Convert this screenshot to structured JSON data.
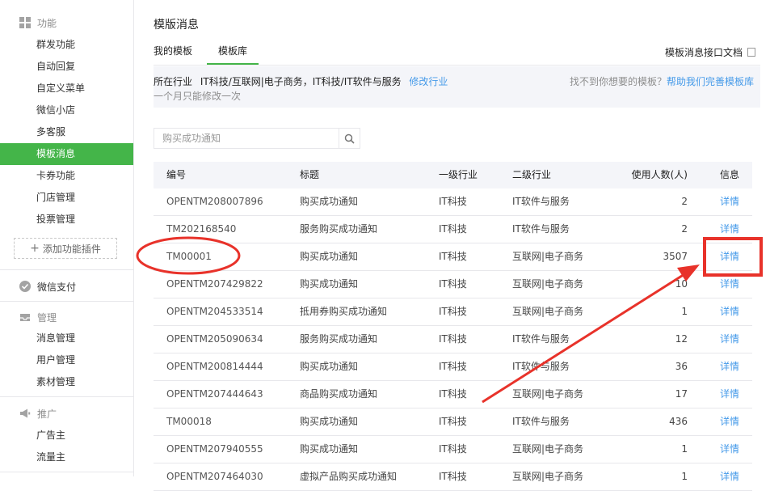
{
  "sidebar": {
    "features_header": "功能",
    "features": [
      "群发功能",
      "自动回复",
      "自定义菜单",
      "微信小店",
      "多客服",
      "模板消息",
      "卡券功能",
      "门店管理",
      "投票管理"
    ],
    "active_feature": "模板消息",
    "add_plugin": "添加功能插件",
    "payment": "微信支付",
    "manage_header": "管理",
    "manage": [
      "消息管理",
      "用户管理",
      "素材管理"
    ],
    "promote_header": "推广",
    "promote": [
      "广告主",
      "流量主"
    ]
  },
  "main": {
    "page_title": "模版消息",
    "tabs": [
      "我的模板",
      "模板库"
    ],
    "active_tab": "模板库",
    "doc_link": "模板消息接口文档",
    "industry": {
      "label": "所在行业",
      "value": "IT科技/互联网|电子商务，IT科技/IT软件与服务",
      "modify_link": "修改行业",
      "note": "一个月只能修改一次",
      "help_prefix": "找不到你想要的模板？",
      "help_link": "帮助我们完善模板库"
    },
    "search_placeholder": "购买成功通知",
    "columns": [
      "编号",
      "标题",
      "一级行业",
      "二级行业",
      "使用人数(人)",
      "信息"
    ],
    "rows": [
      {
        "id": "OPENTM208007896",
        "title": "购买成功通知",
        "l1": "IT科技",
        "l2": "IT软件与服务",
        "users": "2",
        "info": "详情"
      },
      {
        "id": "TM202168540",
        "title": "服务购买成功通知",
        "l1": "IT科技",
        "l2": "IT软件与服务",
        "users": "2",
        "info": "详情"
      },
      {
        "id": "TM00001",
        "title": "购买成功通知",
        "l1": "IT科技",
        "l2": "互联网|电子商务",
        "users": "3507",
        "info": "详情"
      },
      {
        "id": "OPENTM207429822",
        "title": "购买成功通知",
        "l1": "IT科技",
        "l2": "互联网|电子商务",
        "users": "10",
        "info": "详情"
      },
      {
        "id": "OPENTM204533514",
        "title": "抵用券购买成功通知",
        "l1": "IT科技",
        "l2": "互联网|电子商务",
        "users": "1",
        "info": "详情"
      },
      {
        "id": "OPENTM205090634",
        "title": "服务购买成功通知",
        "l1": "IT科技",
        "l2": "IT软件与服务",
        "users": "12",
        "info": "详情"
      },
      {
        "id": "OPENTM200814444",
        "title": "购买成功通知",
        "l1": "IT科技",
        "l2": "IT软件与服务",
        "users": "36",
        "info": "详情"
      },
      {
        "id": "OPENTM207444643",
        "title": "商品购买成功通知",
        "l1": "IT科技",
        "l2": "互联网|电子商务",
        "users": "17",
        "info": "详情"
      },
      {
        "id": "TM00018",
        "title": "购买成功通知",
        "l1": "IT科技",
        "l2": "IT软件与服务",
        "users": "436",
        "info": "详情"
      },
      {
        "id": "OPENTM207940555",
        "title": "购买成功通知",
        "l1": "IT科技",
        "l2": "互联网|电子商务",
        "users": "1",
        "info": "详情"
      },
      {
        "id": "OPENTM207464030",
        "title": "虚拟产品购买成功通知",
        "l1": "IT科技",
        "l2": "互联网|电子商务",
        "users": "1",
        "info": "详情"
      }
    ]
  },
  "colors": {
    "accent": "#44b549",
    "link": "#459ae9",
    "annotation": "#e8322a",
    "bar": "#f4f5f9"
  }
}
